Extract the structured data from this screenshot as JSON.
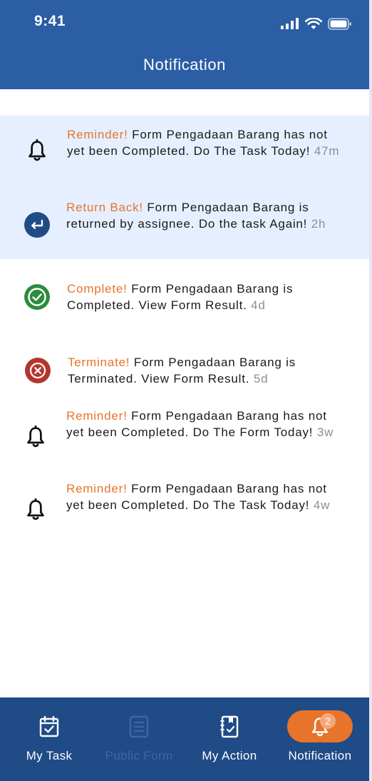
{
  "status_bar": {
    "time": "9:41"
  },
  "header": {
    "title": "Notification"
  },
  "notifications": [
    {
      "icon": "bell-icon",
      "keyword": "Reminder!",
      "message": " Form Pengadaan Barang has not yet been Completed. Do The Task Today! ",
      "time": "47m",
      "unread": true
    },
    {
      "icon": "return-icon",
      "keyword": "Return Back!",
      "message": " Form Pengadaan Barang is returned by assignee. Do the task Again! ",
      "time": "2h",
      "unread": true
    },
    {
      "icon": "check-circle-icon",
      "keyword": "Complete!",
      "message": " Form Pengadaan Barang is Completed. View Form Result. ",
      "time": "4d",
      "unread": false
    },
    {
      "icon": "x-circle-icon",
      "keyword": "Terminate!",
      "message": " Form Pengadaan Barang is Terminated. View Form Result. ",
      "time": "5d",
      "unread": false
    },
    {
      "icon": "bell-icon",
      "keyword": "Reminder!",
      "message": " Form Pengadaan Barang has not yet been Completed. Do The Form Today! ",
      "time": "3w",
      "unread": false
    },
    {
      "icon": "bell-icon",
      "keyword": "Reminder!",
      "message": " Form Pengadaan Barang has not yet been Completed. Do The Task Today! ",
      "time": "4w",
      "unread": false
    }
  ],
  "tabbar": {
    "tabs": [
      {
        "label": "My Task",
        "icon": "task-check-icon",
        "state": "normal"
      },
      {
        "label": "Public Form",
        "icon": "form-icon",
        "state": "disabled"
      },
      {
        "label": "My Action",
        "icon": "action-icon",
        "state": "normal"
      },
      {
        "label": "Notification",
        "icon": "bell-icon",
        "state": "active"
      }
    ],
    "notification_badge": "2"
  },
  "colors": {
    "header": "#2b5ea4",
    "tabbar": "#1f4b86",
    "accent": "#e8732a",
    "unread_bg": "#e6efff",
    "complete": "#2e8b3e",
    "terminate": "#b5342b",
    "return": "#1f4b86"
  }
}
